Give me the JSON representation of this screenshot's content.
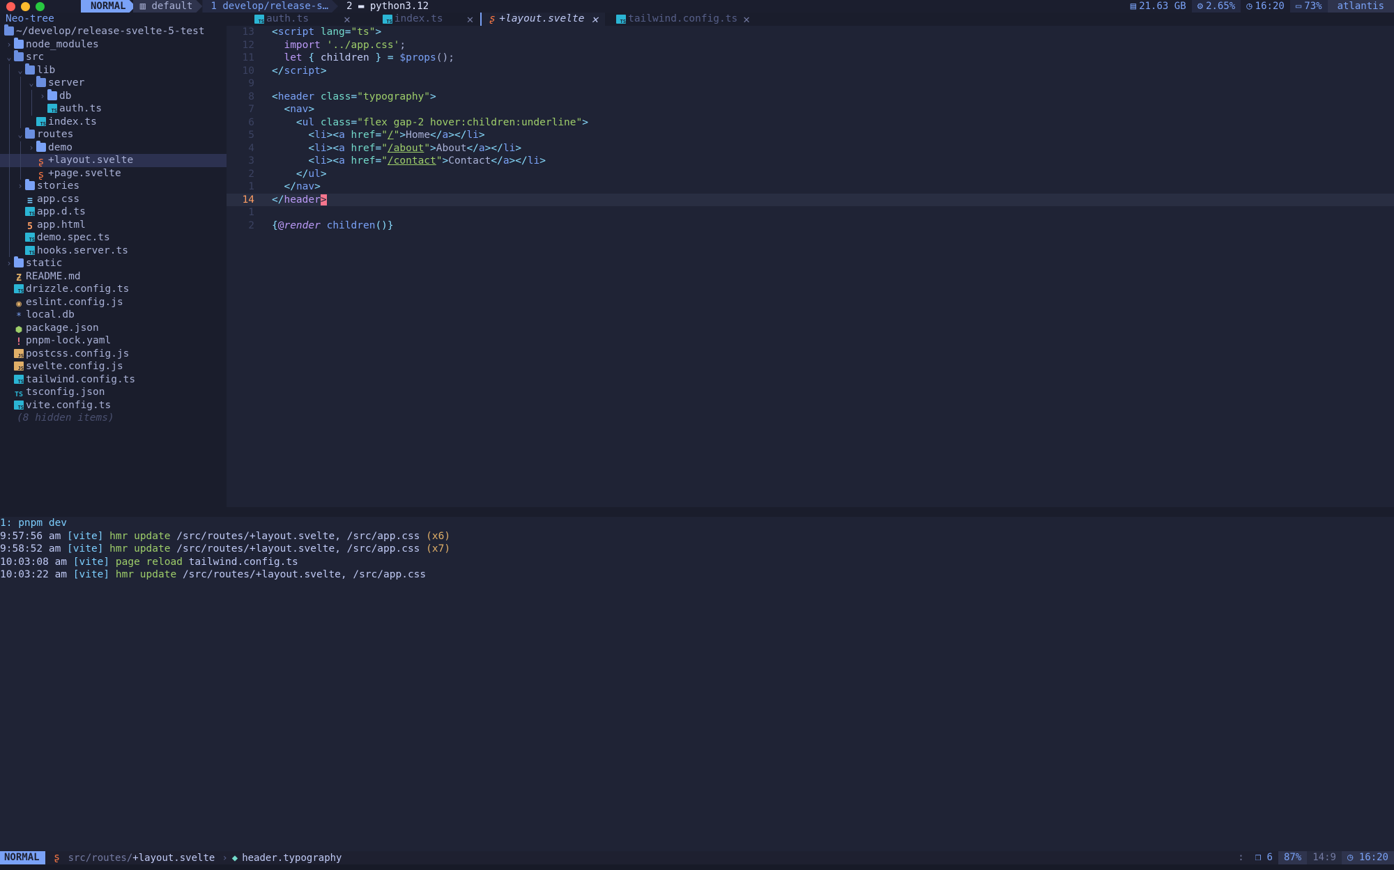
{
  "tmux": {
    "mode": "NORMAL",
    "session": "default",
    "windows": [
      {
        "index": "1",
        "name": "develop/release-s…"
      },
      {
        "index": "2",
        "name": "python3.12"
      }
    ],
    "stats": {
      "disk": "21.63 GB",
      "cpu": "2.65%",
      "time": "16:20",
      "battery": "73%",
      "host": "atlantis"
    }
  },
  "sidebar": {
    "title": "Neo-tree",
    "root": "~/develop/release-svelte-5-test",
    "items": [
      {
        "label": "node_modules",
        "type": "folder",
        "depth": 1,
        "open": false
      },
      {
        "label": "src",
        "type": "folder",
        "depth": 1,
        "open": true
      },
      {
        "label": "lib",
        "type": "folder",
        "depth": 2,
        "open": true
      },
      {
        "label": "server",
        "type": "folder",
        "depth": 3,
        "open": true
      },
      {
        "label": "db",
        "type": "folder",
        "depth": 4,
        "open": false
      },
      {
        "label": "auth.ts",
        "type": "ts",
        "depth": 4
      },
      {
        "label": "index.ts",
        "type": "ts",
        "depth": 3
      },
      {
        "label": "routes",
        "type": "folder",
        "depth": 2,
        "open": true
      },
      {
        "label": "demo",
        "type": "folder",
        "depth": 3,
        "open": false
      },
      {
        "label": "+layout.svelte",
        "type": "svelte",
        "depth": 3,
        "selected": true
      },
      {
        "label": "+page.svelte",
        "type": "svelte",
        "depth": 3
      },
      {
        "label": "stories",
        "type": "folder",
        "depth": 2,
        "open": false
      },
      {
        "label": "app.css",
        "type": "css",
        "depth": 2
      },
      {
        "label": "app.d.ts",
        "type": "ts",
        "depth": 2
      },
      {
        "label": "app.html",
        "type": "html",
        "depth": 2
      },
      {
        "label": "demo.spec.ts",
        "type": "ts",
        "depth": 2
      },
      {
        "label": "hooks.server.ts",
        "type": "ts",
        "depth": 2
      },
      {
        "label": "static",
        "type": "folder",
        "depth": 1,
        "open": false
      },
      {
        "label": "README.md",
        "type": "md",
        "depth": 1
      },
      {
        "label": "drizzle.config.ts",
        "type": "ts",
        "depth": 1
      },
      {
        "label": "eslint.config.js",
        "type": "eslint",
        "depth": 1
      },
      {
        "label": "local.db",
        "type": "db",
        "depth": 1
      },
      {
        "label": "package.json",
        "type": "pkg",
        "depth": 1
      },
      {
        "label": "pnpm-lock.yaml",
        "type": "yaml",
        "depth": 1
      },
      {
        "label": "postcss.config.js",
        "type": "js",
        "depth": 1
      },
      {
        "label": "svelte.config.js",
        "type": "js",
        "depth": 1
      },
      {
        "label": "tailwind.config.ts",
        "type": "ts",
        "depth": 1
      },
      {
        "label": "tsconfig.json",
        "type": "tsconf",
        "depth": 1
      },
      {
        "label": "vite.config.ts",
        "type": "ts",
        "depth": 1
      }
    ],
    "hidden_note": "(8 hidden items)"
  },
  "tabs": [
    {
      "label": "auth.ts",
      "icon": "ts",
      "active": false
    },
    {
      "label": "index.ts",
      "icon": "ts",
      "active": false
    },
    {
      "label": "+layout.svelte",
      "icon": "svelte",
      "active": true
    },
    {
      "label": "tailwind.config.ts",
      "icon": "ts",
      "active": false
    }
  ],
  "editor": {
    "line_numbers": [
      "13",
      "12",
      "11",
      "10",
      "9",
      "8",
      "7",
      "6",
      "5",
      "4",
      "3",
      "2",
      "1",
      "14",
      "1",
      "2"
    ],
    "current_line_index": 13
  },
  "terminal": {
    "title": "1: pnpm dev",
    "lines": [
      {
        "time": "9:57:56 am",
        "tag": "[vite]",
        "action": "hmr update",
        "detail": "/src/routes/+layout.svelte, /src/app.css",
        "count": "(x6)"
      },
      {
        "time": "9:58:52 am",
        "tag": "[vite]",
        "action": "hmr update",
        "detail": "/src/routes/+layout.svelte, /src/app.css",
        "count": "(x7)"
      },
      {
        "time": "10:03:08 am",
        "tag": "[vite]",
        "action": "page reload",
        "detail": "tailwind.config.ts",
        "count": ""
      },
      {
        "time": "10:03:22 am",
        "tag": "[vite]",
        "action": "hmr update",
        "detail": "/src/routes/+layout.svelte, /src/app.css",
        "count": ""
      }
    ]
  },
  "statusline": {
    "mode": "NORMAL",
    "path_prefix": "src/routes/",
    "filename": "+layout.svelte",
    "breadcrumb": "header.typography",
    "colon": ":",
    "lsp_count": "6",
    "progress": "87%",
    "position": "14:9",
    "time": "16:20"
  },
  "colors": {
    "accent": "#7aa2f7",
    "background": "#1f2335",
    "sidebar": "#1a1d2c",
    "cursor": "#f7768e"
  }
}
